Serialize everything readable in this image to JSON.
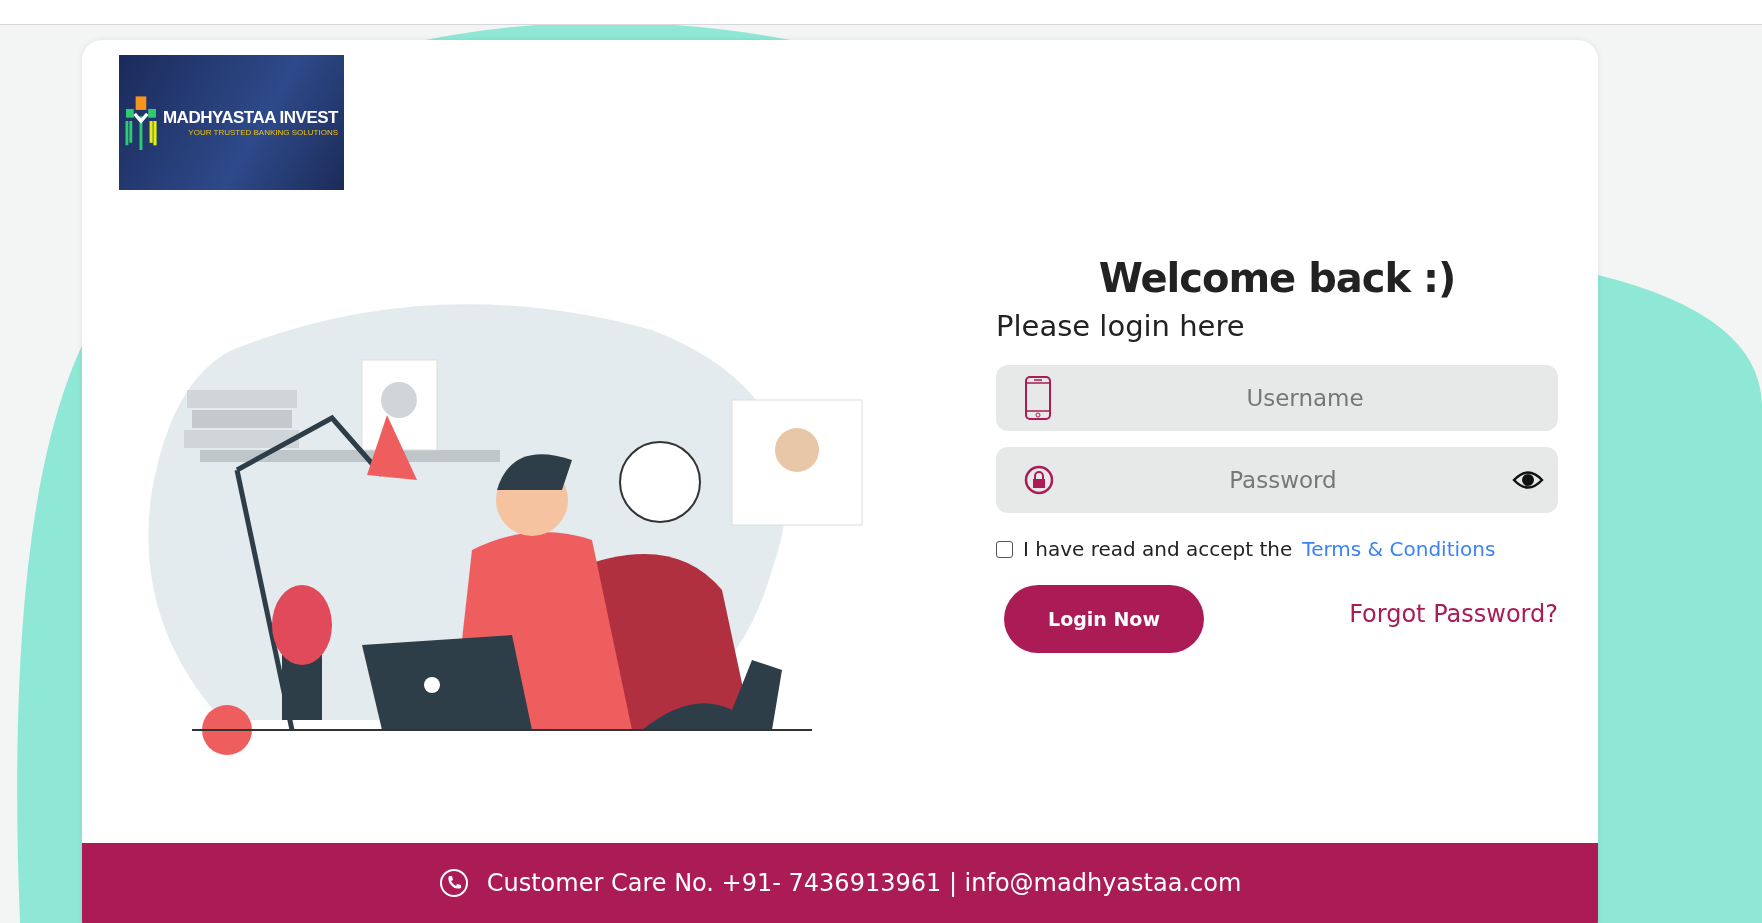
{
  "logo": {
    "name": "MADHYASTAA INVEST",
    "tagline": "YOUR TRUSTED BANKING SOLUTIONS"
  },
  "login": {
    "title": "Welcome back :)",
    "subtitle": "Please login here",
    "username": {
      "placeholder": "Username"
    },
    "password": {
      "placeholder": "Password"
    },
    "terms": {
      "checked": false,
      "text": "I have read and accept the",
      "link": "Terms & Conditions"
    },
    "submit": "Login Now",
    "forgot": "Forgot Password?"
  },
  "footer": {
    "text": "Customer Care No. +91- 7436913961 | info@madhyastaa.com"
  }
}
